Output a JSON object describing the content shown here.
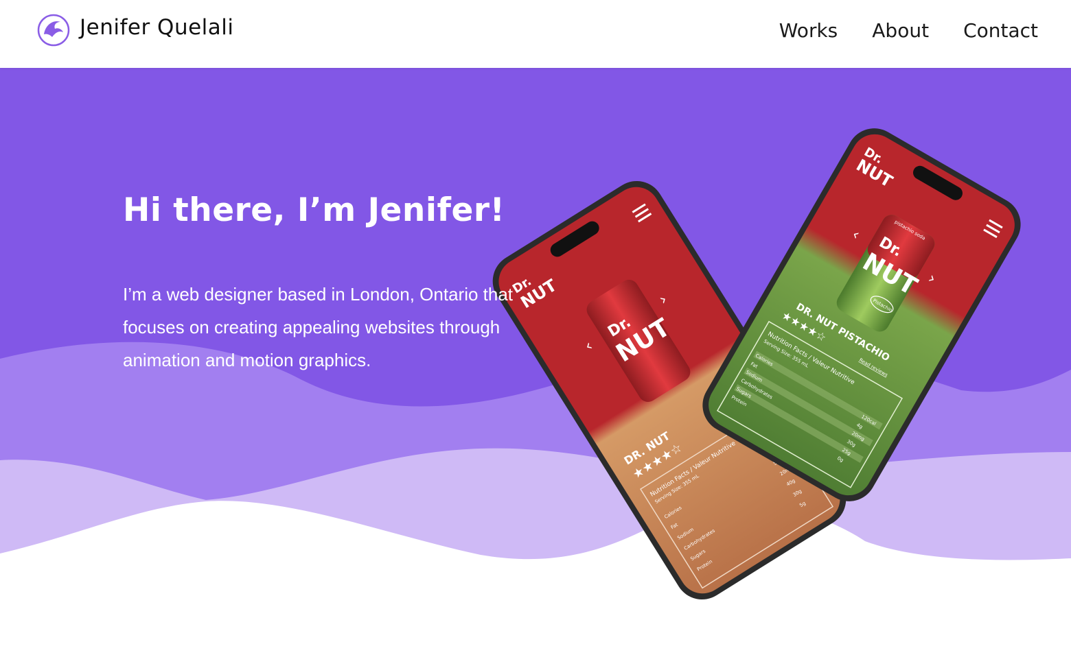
{
  "brand": {
    "name": "Jenifer Quelali",
    "logo_icon": "bird-logo-icon"
  },
  "nav": {
    "items": [
      {
        "label": "Works"
      },
      {
        "label": "About"
      },
      {
        "label": "Contact"
      }
    ]
  },
  "hero": {
    "title": "Hi there, I’m Jenifer!",
    "description": "I’m a web designer based in London, Ontario that focuses on creating appealing websites through animation and motion graphics."
  },
  "mockup": {
    "back_phone": {
      "logo_top": "Dr.",
      "logo_bottom": "NUT",
      "product": "DR. NUT",
      "nutrition_title": "Nutrition Facts / Valeur Nutritive",
      "serving": "Serving Size: 355 mL",
      "rows": [
        "Calories",
        "Fat",
        "Sodium",
        "Carbohydrates",
        "Sugars",
        "Protein"
      ],
      "amounts": [
        "120cal",
        "5g",
        "20mg",
        "40g",
        "30g",
        "5g"
      ]
    },
    "front_phone": {
      "logo_top": "Dr.",
      "logo_bottom": "NUT",
      "can_label": "pistachio soda",
      "flavor_badge": "Pistachio",
      "product": "DR. NUT PISTACHIO",
      "reviews": "Read reviews",
      "nutrition_title": "Nutrition Facts / Valeur Nutritive",
      "serving": "Serving Size: 355 mL",
      "rows": [
        "Calories",
        "Fat",
        "Sodium",
        "Carbohydrates",
        "Sugars",
        "Protein"
      ],
      "amounts": [
        "120cal",
        "4g",
        "20mg",
        "30g",
        "25g",
        "0g"
      ]
    }
  },
  "colors": {
    "accent": "#8257e6",
    "wave_mid": "#a27ff0",
    "wave_light": "#cfbaf6",
    "can_red": "#c0262c",
    "pistachio_green": "#6f9a3e",
    "caramel": "#c8865a"
  }
}
